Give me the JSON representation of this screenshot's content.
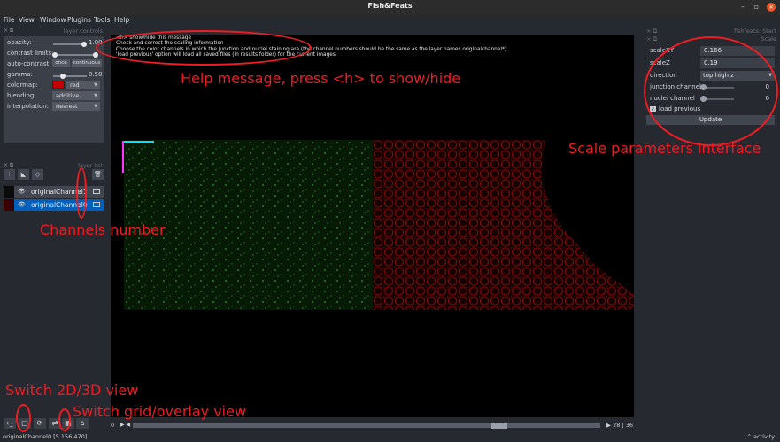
{
  "window": {
    "title": "Fish&Feats",
    "min": "–",
    "max": "▫",
    "close": "×"
  },
  "menu": [
    "File",
    "View",
    "Window",
    "Plugins",
    "Tools",
    "Help"
  ],
  "layer_controls": {
    "title": "layer controls",
    "opacity_label": "opacity:",
    "opacity_value": "1.00",
    "contrast_label": "contrast limits:",
    "autocontrast_label": "auto-contrast:",
    "once_label": "once",
    "continuous_label": "continuous",
    "gamma_label": "gamma:",
    "gamma_value": "0.50",
    "colormap_label": "colormap:",
    "colormap_value": "red",
    "blending_label": "blending:",
    "blending_value": "additive",
    "interpolation_label": "interpolation:",
    "interpolation_value": "nearest"
  },
  "layer_list": {
    "title": "layer list",
    "layers": [
      {
        "name": "originalChannel1",
        "selected": false
      },
      {
        "name": "originalChannel0",
        "selected": true
      }
    ]
  },
  "help_lines": [
    "<h> show/hide this message",
    "Check and correct the scaling information",
    "Choose the color channels in which the junction and nuclei staining are (the channel numbers should be the same as the layer names originalchannel*)",
    "'load previous' option will load all saved files (in results folder) for the current images"
  ],
  "annotations": {
    "help": "Help message, press <h> to show/hide",
    "scale": "Scale parameters interface",
    "channels": "Channels number",
    "switch3d": "Switch 2D/3D view",
    "switchgrid": "Switch grid/overlay view"
  },
  "dims": {
    "axis": "0",
    "current": "28",
    "total": "36"
  },
  "right_panel": {
    "title": "fishfeats: Start",
    "subtitle": "Scale",
    "scaleXY_label": "scaleXY",
    "scaleXY_value": "0.166",
    "scaleZ_label": "scaleZ",
    "scaleZ_value": "0.19",
    "direction_label": "direction",
    "direction_value": "top high z",
    "junction_label": "junction channel",
    "junction_value": "0",
    "nuclei_label": "nuclei channel",
    "nuclei_value": "0",
    "load_previous_label": "load previous",
    "update_label": "Update"
  },
  "status": {
    "left": "originalChannel0 [5 156 470]",
    "right": "⌃ activity"
  }
}
